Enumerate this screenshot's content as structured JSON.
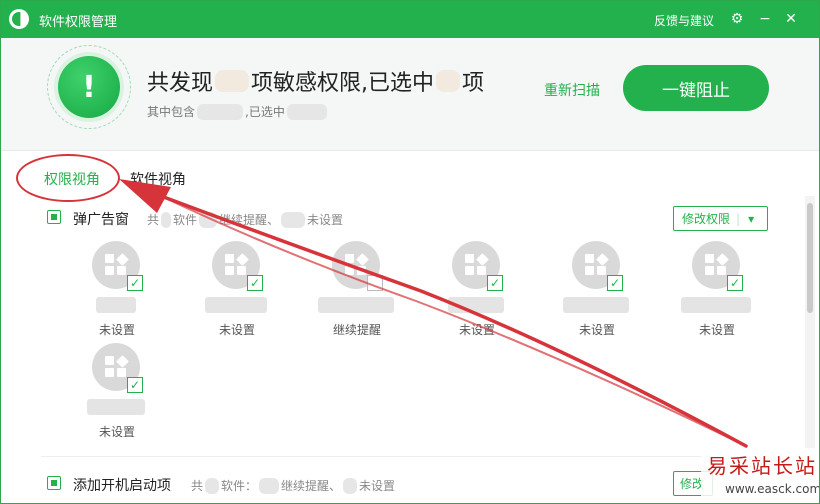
{
  "titlebar": {
    "title": "软件权限管理",
    "feedback": "反馈与建议",
    "gear_glyph": "⚙",
    "min_glyph": "−",
    "close_glyph": "✕"
  },
  "header": {
    "found_prefix": "共发现",
    "found_mid": "项敏感权限,已选中",
    "found_suffix": "项",
    "shield_mark": "!",
    "sub_prefix": "其中包含",
    "sub_mid": ",已选中",
    "rescan": "重新扫描",
    "block_button": "一键阻止"
  },
  "tabs": {
    "perm_view": "权限视角",
    "soft_view": "软件视角"
  },
  "sections": {
    "popup": {
      "title": "弹广告窗",
      "meta_prefix": "共",
      "meta_mid1": "软件",
      "meta_mid2": "继续提醒、",
      "meta_suffix": "未设置",
      "modify": "修改权限",
      "modify_caret": "▾"
    },
    "startup": {
      "title": "添加开机启动项",
      "meta_prefix": "共",
      "meta_mid1": "软件：",
      "meta_mid2": "继续提醒、",
      "meta_suffix": "未设置",
      "modify": "修改"
    }
  },
  "apps": [
    {
      "status": "未设置",
      "checked": true
    },
    {
      "status": "未设置",
      "checked": true
    },
    {
      "status": "继续提醒",
      "checked": false
    },
    {
      "status": "未设置",
      "checked": true
    },
    {
      "status": "未设置",
      "checked": true
    },
    {
      "status": "未设置",
      "checked": true
    },
    {
      "status": "未设置",
      "checked": true
    }
  ],
  "check_glyph": "✓",
  "watermark": {
    "main": "易采站长站",
    "url": "www.easck.com"
  },
  "colors": {
    "brand_green": "#23b14d",
    "annotation_red": "#d6343a"
  }
}
